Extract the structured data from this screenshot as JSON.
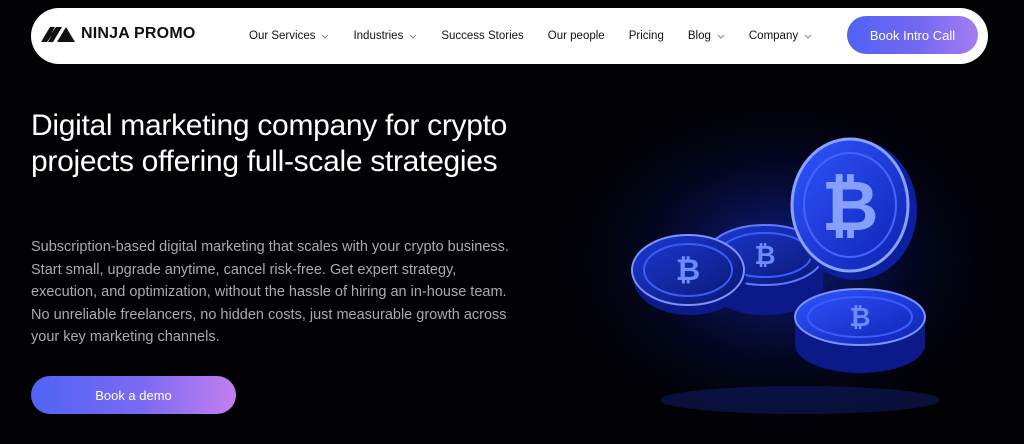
{
  "navbar": {
    "logo_text": "NINJA PROMO",
    "items": [
      {
        "label": "Our Services",
        "has_dropdown": true
      },
      {
        "label": "Industries",
        "has_dropdown": true
      },
      {
        "label": "Success Stories",
        "has_dropdown": false
      },
      {
        "label": "Our people",
        "has_dropdown": false
      },
      {
        "label": "Pricing",
        "has_dropdown": false
      },
      {
        "label": "Blog",
        "has_dropdown": true
      },
      {
        "label": "Company",
        "has_dropdown": true
      }
    ],
    "cta_label": "Book Intro Call"
  },
  "hero": {
    "title": "Digital marketing company for crypto projects offering full-scale strategies",
    "description": "Subscription-based digital marketing that scales with your crypto business. Start small, upgrade anytime, cancel risk-free. Get expert strategy, execution, and optimization, without the hassle of hiring an in-house team. No unreliable freelancers, no hidden costs, just measurable growth across your key marketing channels.",
    "cta_label": "Book a demo"
  },
  "illustration": {
    "icon": "bitcoin-coins-icon",
    "glow_color": "#2d4bff"
  },
  "colors": {
    "background": "#020205",
    "accent_start": "#4f63f5",
    "accent_end": "#c37ff0",
    "body_text": "#a9a9b0"
  }
}
